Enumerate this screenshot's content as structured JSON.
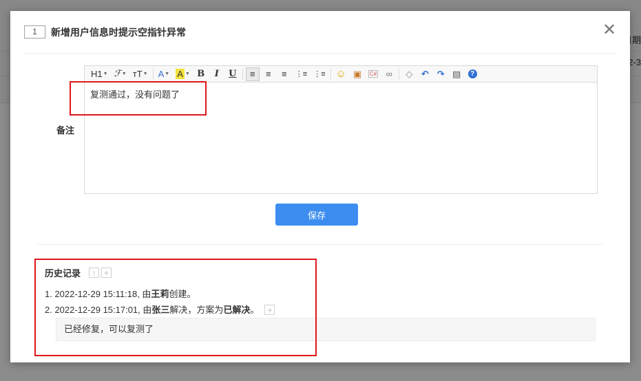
{
  "background": {
    "right_text_top": "日期",
    "right_text_second": "2-3"
  },
  "modal": {
    "id_badge": "1",
    "title": "新增用户信息时提示空指针异常",
    "close_symbol": "✕"
  },
  "form": {
    "remark_label": "备注"
  },
  "editor": {
    "toolbar": [
      {
        "name": "heading",
        "label": "H1",
        "dropdown": true
      },
      {
        "name": "font-family",
        "label": "ℱ",
        "dropdown": true
      },
      {
        "name": "font-size",
        "label": "тT",
        "dropdown": true
      },
      {
        "name": "font-color",
        "label": "A",
        "dropdown": true
      },
      {
        "name": "highlight",
        "label": "A",
        "dropdown": true
      },
      {
        "name": "bold",
        "label": "B"
      },
      {
        "name": "italic",
        "label": "I"
      },
      {
        "name": "underline",
        "label": "U"
      },
      {
        "name": "align-left",
        "label": "≡",
        "active": true
      },
      {
        "name": "align-center",
        "label": "≡"
      },
      {
        "name": "align-right",
        "label": "≡"
      },
      {
        "name": "ordered-list",
        "label": "⋮≡"
      },
      {
        "name": "unordered-list",
        "label": "⋮≡"
      },
      {
        "name": "emoji",
        "label": "☺"
      },
      {
        "name": "image",
        "label": "▣"
      },
      {
        "name": "code",
        "label": "C#"
      },
      {
        "name": "link",
        "label": "∞"
      },
      {
        "name": "eraser",
        "label": "◇"
      },
      {
        "name": "undo",
        "label": "↶"
      },
      {
        "name": "redo",
        "label": "↷"
      },
      {
        "name": "paste",
        "label": "▤"
      },
      {
        "name": "help",
        "label": "?"
      }
    ],
    "content": "复测通过，没有问题了"
  },
  "save_label": "保存",
  "history": {
    "title": "历史记录",
    "items": [
      {
        "prefix": "1. 2022-12-29 15:11:18, 由 ",
        "user": "王莉",
        "action": " 创建。",
        "resolution": "",
        "suffix": ""
      },
      {
        "prefix": "2. 2022-12-29 15:17:01, 由 ",
        "user": "张三",
        "action": " 解决，方案为 ",
        "resolution": "已解决",
        "suffix": " 。"
      }
    ],
    "comment": "已经修复，可以复测了"
  },
  "colors": {
    "primary_button": "#3d8df0",
    "annotation_red": "#e0161c",
    "overlay": "rgba(0,0,0,0.45)"
  }
}
